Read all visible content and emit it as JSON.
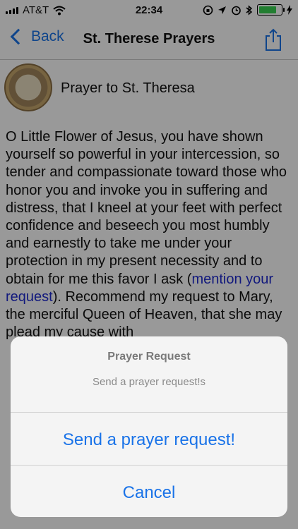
{
  "status_bar": {
    "carrier": "AT&T",
    "time": "22:34",
    "battery_level": 0.85
  },
  "nav": {
    "back_label": "Back",
    "title": "St. Therese Prayers"
  },
  "prayer": {
    "title": "Prayer to St. Theresa",
    "body_part1": "O Little Flower of Jesus, you have shown yourself so powerful in your intercession, so tender and compassionate toward those who honor you and invoke you in suffering and distress, that I kneel at your feet with perfect confidence and beseech you most humbly and earnestly to take me under your protection in my present necessity and to obtain for me this favor I ask (",
    "request_link": "mention your request",
    "body_part2": "). Recommend my request to Mary, the merciful Queen of Heaven, that she may plead my cause with"
  },
  "sheet": {
    "title": "Prayer Request",
    "message": "Send a prayer request!s",
    "action_label": "Send a prayer request!",
    "cancel_label": "Cancel"
  },
  "colors": {
    "accent": "#1a73e8",
    "link": "#1f2bd0"
  }
}
